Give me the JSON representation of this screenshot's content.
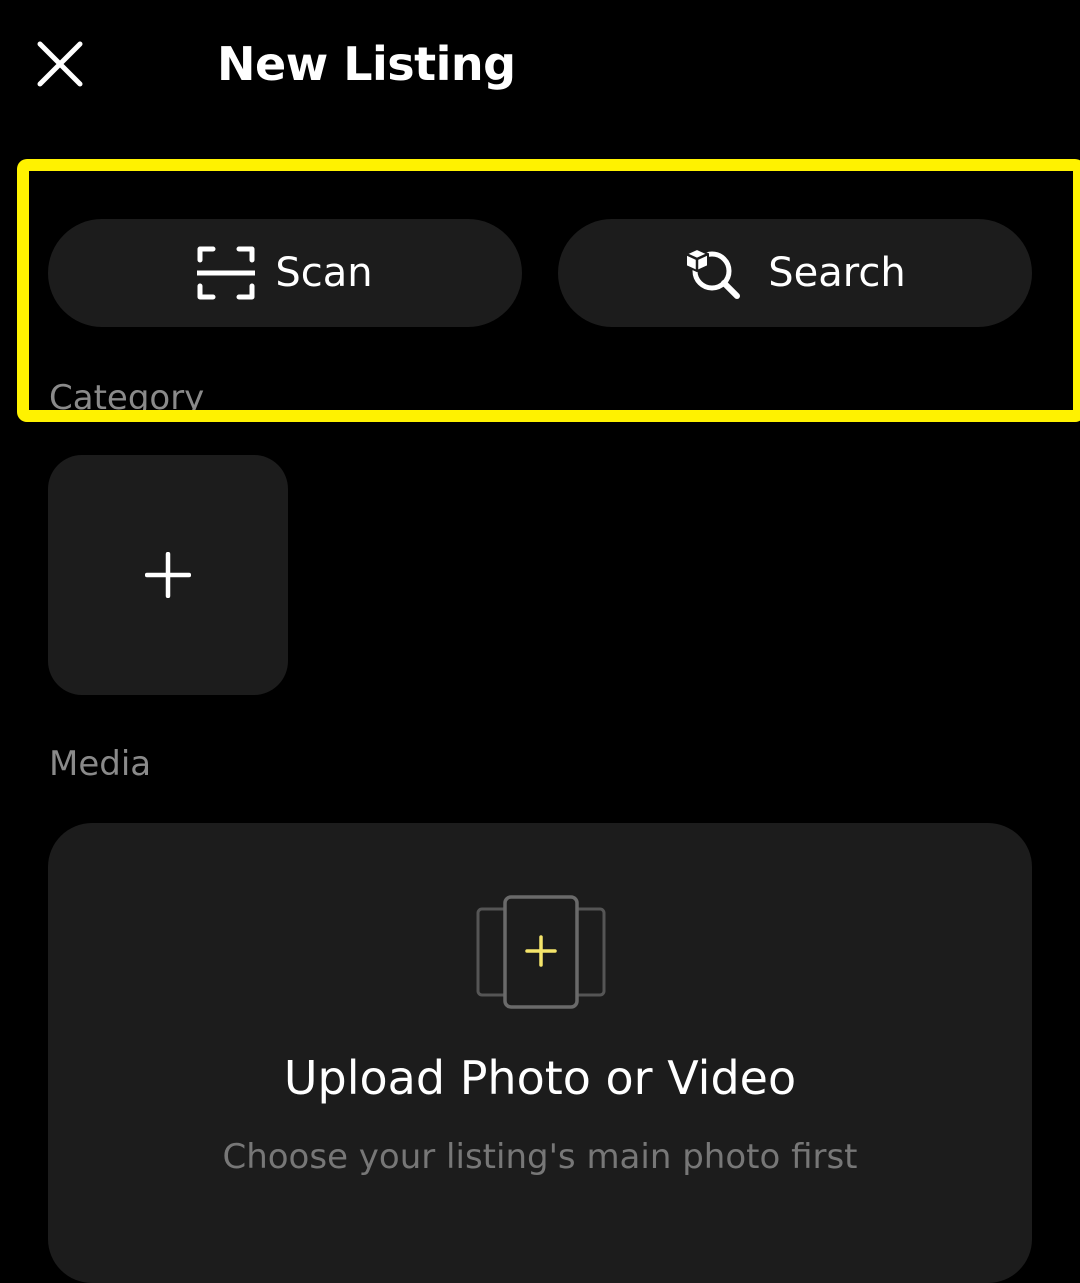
{
  "header": {
    "title": "New Listing",
    "close_icon": "close-icon"
  },
  "actions": {
    "scan": {
      "label": "Scan",
      "icon": "scan-frame-icon"
    },
    "search": {
      "label": "Search",
      "icon": "cube-search-icon"
    }
  },
  "category": {
    "label": "Category",
    "add_icon": "plus-icon"
  },
  "media": {
    "label": "Media",
    "upload_title": "Upload Photo or Video",
    "upload_subtitle": "Choose your listing's main photo first",
    "upload_icon": "add-media-icon"
  },
  "colors": {
    "background": "#000000",
    "surface": "#1c1c1c",
    "highlight": "#fff200",
    "muted_text": "#8a8a8a",
    "accent_plus": "#f5e56b"
  }
}
